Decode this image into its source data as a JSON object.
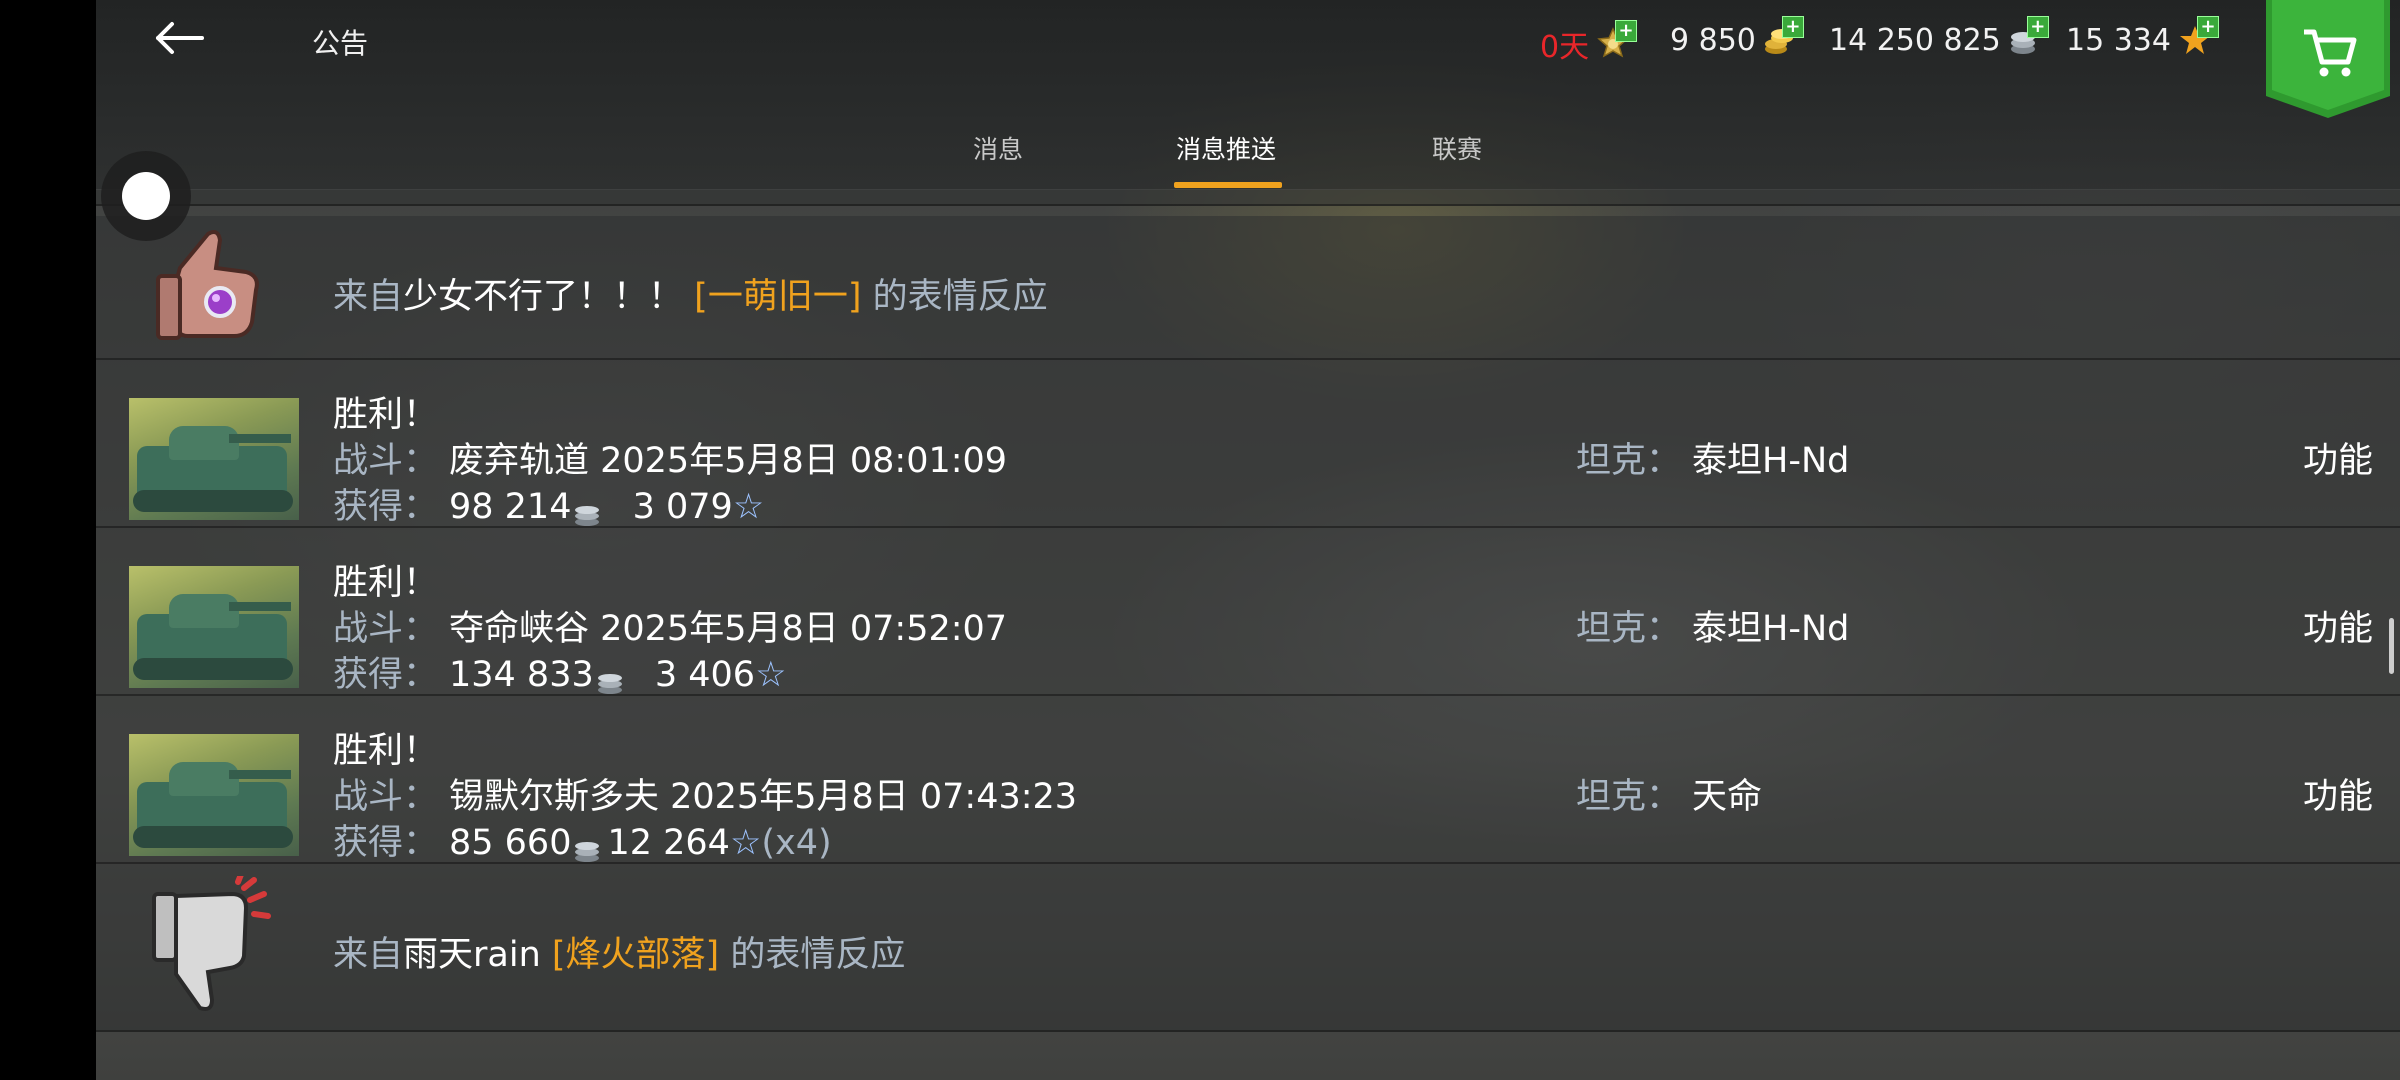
{
  "header": {
    "back_icon": "arrow-left-icon",
    "title": "公告",
    "resources": {
      "premium": {
        "value": "0天",
        "icon": "premium-badge-icon"
      },
      "gold": {
        "value": "9 850",
        "icon": "gold-coins-icon"
      },
      "silver": {
        "value": "14 250 825",
        "icon": "silver-coins-icon"
      },
      "free_xp": {
        "value": "15 334",
        "icon": "star-icon"
      }
    },
    "shop_icon": "cart-icon"
  },
  "tabs": [
    {
      "label": "消息"
    },
    {
      "label": "消息推送",
      "active": true
    },
    {
      "label": "联赛"
    }
  ],
  "messages": [
    {
      "type": "reaction",
      "icon": "thumbs-up-icon",
      "prefix": "来自",
      "player": "少女不行了！！！",
      "clan": "[一萌旧一]",
      "suffix": "的表情反应"
    },
    {
      "type": "battle",
      "result": "胜利！",
      "battle_label": "战斗：",
      "map_time": "废弃轨道 2025年5月8日 08:01:09",
      "earned_label": "获得：",
      "credits": "98 214",
      "xp": "3 079",
      "xp_extra": "",
      "tank_label": "坦克：",
      "tank": "泰坦H-Nd",
      "action": "功能"
    },
    {
      "type": "battle",
      "result": "胜利！",
      "battle_label": "战斗：",
      "map_time": "夺命峡谷 2025年5月8日 07:52:07",
      "earned_label": "获得：",
      "credits": "134 833",
      "xp": "3 406",
      "xp_extra": "",
      "tank_label": "坦克：",
      "tank": "泰坦H-Nd",
      "action": "功能"
    },
    {
      "type": "battle",
      "result": "胜利！",
      "battle_label": "战斗：",
      "map_time": "锡默尔斯多夫 2025年5月8日 07:43:23",
      "earned_label": "获得：",
      "credits": "85 660",
      "xp": "12 264",
      "xp_extra": "(x4)",
      "tank_label": "坦克：",
      "tank": "天命",
      "action": "功能"
    },
    {
      "type": "reaction",
      "icon": "thumbs-down-icon",
      "prefix": "来自",
      "player": "雨天rain",
      "clan": "[烽火部落]",
      "suffix": "的表情反应"
    }
  ],
  "colors": {
    "accent": "#f0a21e",
    "premium_red": "#e8262a",
    "label_grey": "#a9b6c4",
    "shop_green": "#2f9a2f"
  }
}
